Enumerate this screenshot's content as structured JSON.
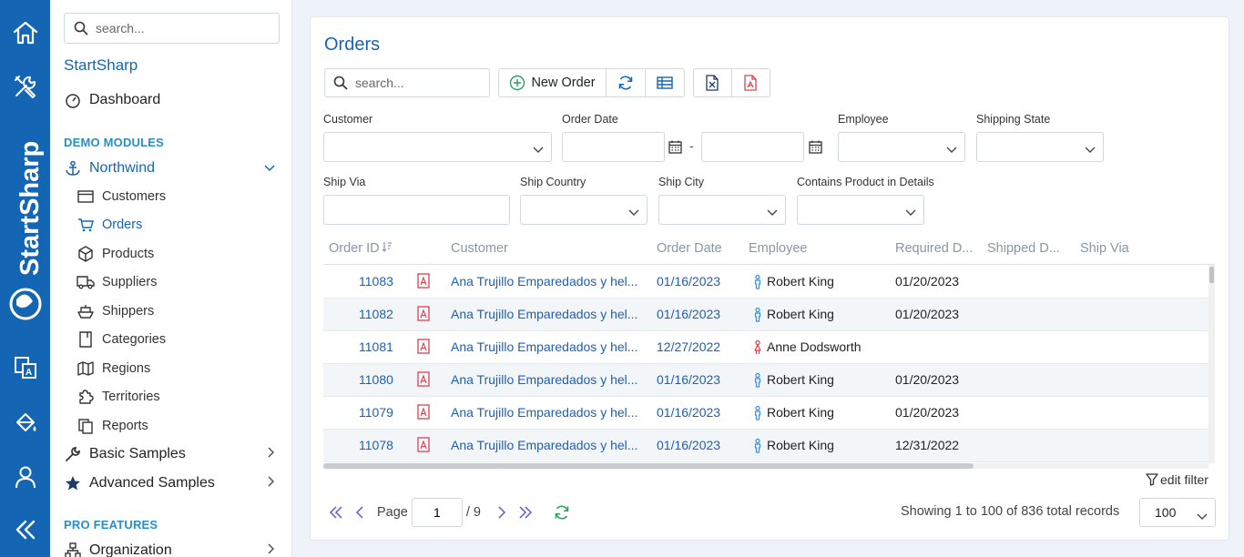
{
  "rail": {
    "brand": "StartSharp",
    "items": [
      "home",
      "tools",
      "translate",
      "theme",
      "user",
      "collapse"
    ]
  },
  "sidebar": {
    "search_placeholder": "search...",
    "app_title": "StartSharp",
    "dashboard": "Dashboard",
    "section_demo": "DEMO MODULES",
    "northwind": "Northwind",
    "northwind_items": [
      "Customers",
      "Orders",
      "Products",
      "Suppliers",
      "Shippers",
      "Categories",
      "Regions",
      "Territories",
      "Reports"
    ],
    "basic_samples": "Basic Samples",
    "advanced_samples": "Advanced Samples",
    "section_pro": "PRO FEATURES",
    "organization": "Organization"
  },
  "page": {
    "title": "Orders",
    "search_placeholder": "search...",
    "new_order": "New Order"
  },
  "filters": {
    "customer": "Customer",
    "order_date": "Order Date",
    "date_separator": "-",
    "employee": "Employee",
    "shipping_state": "Shipping State",
    "ship_via": "Ship Via",
    "ship_country": "Ship Country",
    "ship_city": "Ship City",
    "contains_product": "Contains Product in Details"
  },
  "grid": {
    "columns": [
      "Order ID",
      "Customer",
      "Order Date",
      "Employee",
      "Required D...",
      "Shipped D...",
      "Ship Via"
    ],
    "rows": [
      {
        "id": "11083",
        "customer": "Ana Trujillo Emparedados y hel...",
        "order_date": "01/16/2023",
        "employee": "Robert King",
        "gender": "male",
        "required": "01/20/2023",
        "shipped": "",
        "ship_via": ""
      },
      {
        "id": "11082",
        "customer": "Ana Trujillo Emparedados y hel...",
        "order_date": "01/16/2023",
        "employee": "Robert King",
        "gender": "male",
        "required": "01/20/2023",
        "shipped": "",
        "ship_via": ""
      },
      {
        "id": "11081",
        "customer": "Ana Trujillo Emparedados y hel...",
        "order_date": "12/27/2022",
        "employee": "Anne Dodsworth",
        "gender": "female",
        "required": "",
        "shipped": "",
        "ship_via": ""
      },
      {
        "id": "11080",
        "customer": "Ana Trujillo Emparedados y hel...",
        "order_date": "01/16/2023",
        "employee": "Robert King",
        "gender": "male",
        "required": "01/20/2023",
        "shipped": "",
        "ship_via": ""
      },
      {
        "id": "11079",
        "customer": "Ana Trujillo Emparedados y hel...",
        "order_date": "01/16/2023",
        "employee": "Robert King",
        "gender": "male",
        "required": "01/20/2023",
        "shipped": "",
        "ship_via": ""
      },
      {
        "id": "11078",
        "customer": "Ana Trujillo Emparedados y hel...",
        "order_date": "01/16/2023",
        "employee": "Robert King",
        "gender": "male",
        "required": "12/31/2022",
        "shipped": "",
        "ship_via": ""
      }
    ]
  },
  "footer": {
    "edit_filter": "edit filter",
    "page_label": "Page",
    "current_page": "1",
    "total_pages": "/ 9",
    "showing": "Showing 1 to 100 of 836 total records",
    "page_size": "100"
  },
  "colors": {
    "rail": "#1565b5",
    "accent": "#1565b5",
    "link": "#1e5fb3",
    "pdf": "#d9434f",
    "refresh": "#2aa05a",
    "pager": "#5b5bd6"
  }
}
